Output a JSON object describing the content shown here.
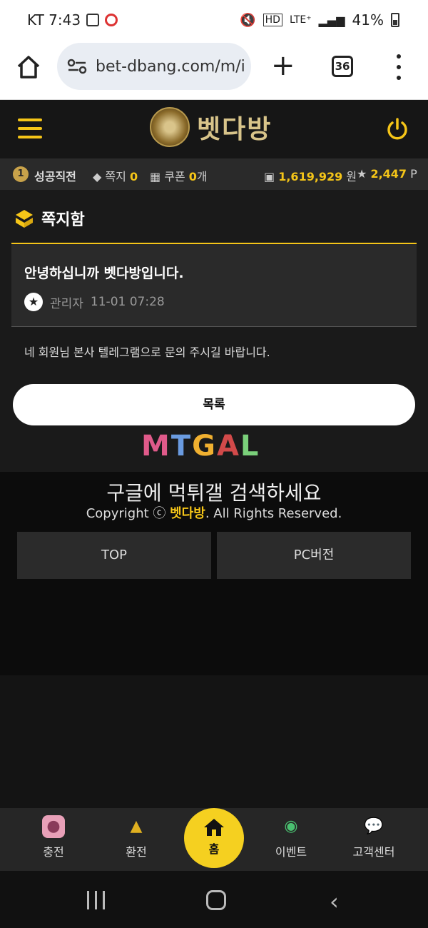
{
  "statusbar": {
    "carrier_time": "KT 7:43",
    "network": "HD",
    "lte": "LTE⁺",
    "battery": "41%"
  },
  "browser": {
    "url": "bet-dbang.com/m/i",
    "tab_count": "36"
  },
  "header": {
    "site_name": "벳다방"
  },
  "infobar": {
    "level": "1",
    "nickname": "성공직전",
    "memo_label": "쪽지",
    "memo_count": "0",
    "coupon_label": "쿠폰",
    "coupon_count": "0",
    "coupon_unit": "개",
    "money": "1,619,929",
    "money_unit": "원",
    "points": "2,447",
    "points_unit": "P"
  },
  "section": {
    "title": "쪽지함"
  },
  "message": {
    "subject": "안녕하십니까 벳다방입니다.",
    "sender": "관리자",
    "datetime": "11-01 07:28",
    "body": "네 회원님 본사 텔레그램으로 문의 주시길 바랍니다."
  },
  "buttons": {
    "list": "목록"
  },
  "watermark": {
    "logo_text": "MTGAL",
    "promo": "구글에 먹튀갤 검색하세요"
  },
  "footer": {
    "copyright_prefix": "Copyright ⓒ",
    "brand": "벳다방",
    "copyright_suffix": ". All Rights Reserved.",
    "top_button": "TOP",
    "pc_button": "PC버전"
  },
  "bottom_nav": {
    "deposit": "충전",
    "withdraw": "환전",
    "home": "홈",
    "event": "이벤트",
    "support": "고객센터"
  },
  "colors": {
    "accent": "#f5c518",
    "home_button": "#f5d020"
  }
}
